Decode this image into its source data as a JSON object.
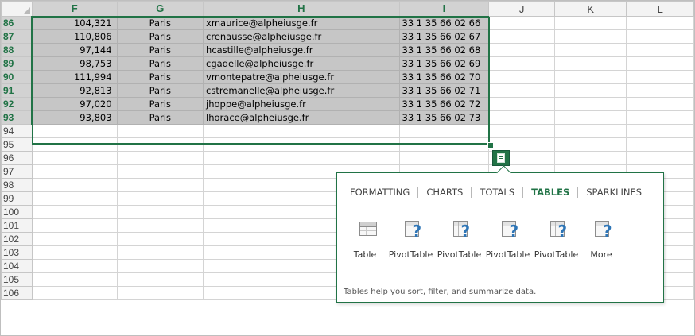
{
  "sheet": {
    "corner": "",
    "columns": [
      "F",
      "G",
      "H",
      "I",
      "J",
      "K",
      "L"
    ],
    "selected_rows": [
      {
        "row": "86",
        "f": "104,321",
        "g": "Paris",
        "h": "xmaurice@alpheiusge.fr",
        "i": "33 1 35 66 02 66"
      },
      {
        "row": "87",
        "f": "110,806",
        "g": "Paris",
        "h": "crenausse@alpheiusge.fr",
        "i": "33 1 35 66 02 67"
      },
      {
        "row": "88",
        "f": "97,144",
        "g": "Paris",
        "h": "hcastille@alpheiusge.fr",
        "i": "33 1 35 66 02 68"
      },
      {
        "row": "89",
        "f": "98,753",
        "g": "Paris",
        "h": "cgadelle@alpheiusge.fr",
        "i": "33 1 35 66 02 69"
      },
      {
        "row": "90",
        "f": "111,994",
        "g": "Paris",
        "h": "vmontepatre@alpheiusge.fr",
        "i": "33 1 35 66 02 70"
      },
      {
        "row": "91",
        "f": "92,813",
        "g": "Paris",
        "h": "cstremanelle@alpheiusge.fr",
        "i": "33 1 35 66 02 71"
      },
      {
        "row": "92",
        "f": "97,020",
        "g": "Paris",
        "h": "jhoppe@alpheiusge.fr",
        "i": "33 1 35 66 02 72"
      },
      {
        "row": "93",
        "f": "93,803",
        "g": "Paris",
        "h": "lhorace@alpheiusge.fr",
        "i": "33 1 35 66 02 73"
      }
    ],
    "empty_rows": [
      "94",
      "95",
      "96",
      "97",
      "98",
      "99",
      "100",
      "101",
      "102",
      "103",
      "104",
      "105",
      "106"
    ]
  },
  "quick_analysis": {
    "button_icon": "quick-analysis-icon",
    "tabs": [
      {
        "label": "FORMATTING",
        "active": false
      },
      {
        "label": "CHARTS",
        "active": false
      },
      {
        "label": "TOTALS",
        "active": false
      },
      {
        "label": "TABLES",
        "active": true
      },
      {
        "label": "SPARKLINES",
        "active": false
      }
    ],
    "items": [
      {
        "label": "Table",
        "icon": "table-icon"
      },
      {
        "label": "PivotTable",
        "icon": "pivottable-icon"
      },
      {
        "label": "PivotTable",
        "icon": "pivottable-icon"
      },
      {
        "label": "PivotTable",
        "icon": "pivottable-icon"
      },
      {
        "label": "PivotTable",
        "icon": "pivottable-icon"
      },
      {
        "label": "More",
        "icon": "more-pivottable-icon"
      }
    ],
    "hint": "Tables help you sort, filter, and summarize data."
  },
  "colors": {
    "accent": "#217346",
    "selection_fill": "#c6c6c6",
    "header_fill": "#f3f3f3"
  }
}
